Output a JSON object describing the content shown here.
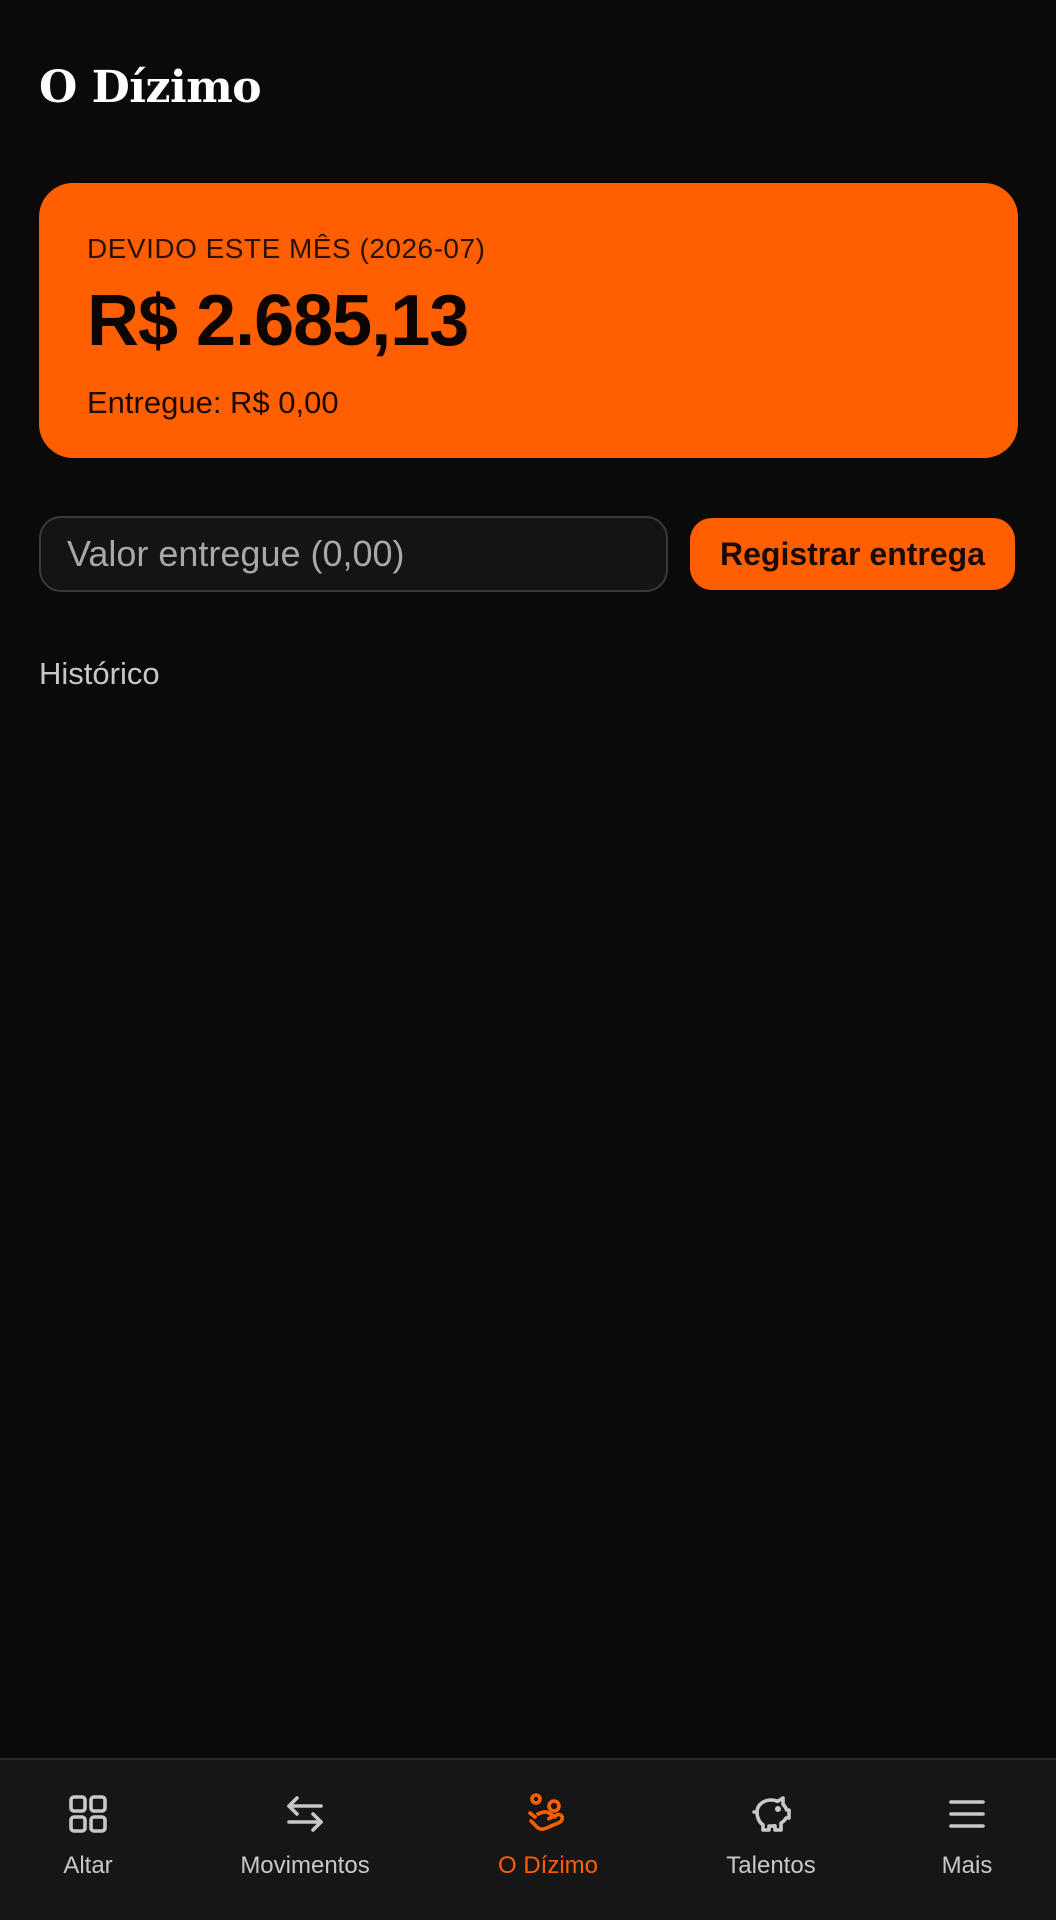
{
  "header": {
    "title": "O Dízimo"
  },
  "due_card": {
    "label": "DEVIDO ESTE MÊS (2026-07)",
    "amount": "R$ 2.685,13",
    "delivered": "Entregue: R$ 0,00"
  },
  "form": {
    "input_placeholder": "Valor entregue (0,00)",
    "input_value": "",
    "submit_label": "Registrar entrega"
  },
  "history": {
    "label": "Histórico"
  },
  "nav": {
    "items": [
      {
        "label": "Altar",
        "icon": "grid-icon",
        "active": false
      },
      {
        "label": "Movimentos",
        "icon": "arrows-swap-icon",
        "active": false
      },
      {
        "label": "O Dízimo",
        "icon": "hand-coins-icon",
        "active": true
      },
      {
        "label": "Talentos",
        "icon": "piggy-bank-icon",
        "active": false
      },
      {
        "label": "Mais",
        "icon": "menu-icon",
        "active": false
      }
    ]
  },
  "colors": {
    "accent": "#ff5f00",
    "background": "#0a0a0a",
    "nav_background": "#161616",
    "inactive": "#c8c8c8"
  }
}
